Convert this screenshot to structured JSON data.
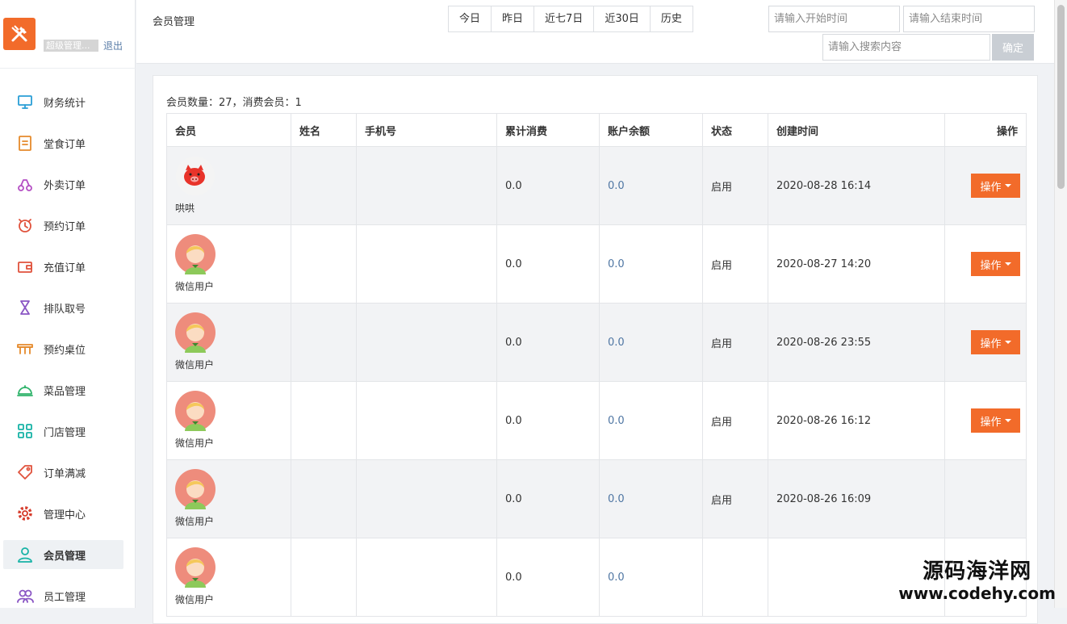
{
  "sidebar": {
    "brand_icon": "fork-knife-icon",
    "user_label": "超级管理...",
    "logout_label": "退出",
    "items": [
      {
        "label": "财务统计",
        "icon": "monitor-icon",
        "color": "#2a9ed6"
      },
      {
        "label": "堂食订单",
        "icon": "clipboard-icon",
        "color": "#e58a2c"
      },
      {
        "label": "外卖订单",
        "icon": "scooter-icon",
        "color": "#b44fc4"
      },
      {
        "label": "预约订单",
        "icon": "alarm-clock-icon",
        "color": "#e0523c"
      },
      {
        "label": "充值订单",
        "icon": "wallet-icon",
        "color": "#e0523c"
      },
      {
        "label": "排队取号",
        "icon": "hourglass-icon",
        "color": "#8a56c4"
      },
      {
        "label": "预约桌位",
        "icon": "table-icon",
        "color": "#e58a2c"
      },
      {
        "label": "菜品管理",
        "icon": "food-cover-icon",
        "color": "#2eb36a"
      },
      {
        "label": "门店管理",
        "icon": "grid-icon",
        "color": "#17b3a6"
      },
      {
        "label": "订单满减",
        "icon": "tag-icon",
        "color": "#e0523c"
      },
      {
        "label": "管理中心",
        "icon": "gear-icon",
        "color": "#d63c2c"
      },
      {
        "label": "会员管理",
        "icon": "user-icon",
        "color": "#17b3a6",
        "active": true
      },
      {
        "label": "员工管理",
        "icon": "users-icon",
        "color": "#8a56c4"
      }
    ]
  },
  "header": {
    "title": "会员管理",
    "ranges": [
      "今日",
      "昨日",
      "近七7日",
      "近30日",
      "历史"
    ],
    "start_placeholder": "请输入开始时间",
    "end_placeholder": "请输入结束时间",
    "search_placeholder": "请输入搜索内容",
    "confirm_label": "确定"
  },
  "content": {
    "summary": "会员数量：27，消费会员：1",
    "columns": [
      "会员",
      "姓名",
      "手机号",
      "累计消费",
      "账户余额",
      "状态",
      "创建时间",
      "操作"
    ],
    "rows": [
      {
        "avatar": "pig-avatar-icon",
        "member": "哄哄",
        "name": "",
        "phone": "",
        "total": "0.0",
        "balance": "0.0",
        "status": "启用",
        "created": "2020-08-28 16:14",
        "action": "操作"
      },
      {
        "avatar": "wechat-user-avatar-icon",
        "member": "微信用户",
        "name": "",
        "phone": "",
        "total": "0.0",
        "balance": "0.0",
        "status": "启用",
        "created": "2020-08-27 14:20",
        "action": "操作"
      },
      {
        "avatar": "wechat-user-avatar-icon",
        "member": "微信用户",
        "name": "",
        "phone": "",
        "total": "0.0",
        "balance": "0.0",
        "status": "启用",
        "created": "2020-08-26 23:55",
        "action": "操作"
      },
      {
        "avatar": "wechat-user-avatar-icon",
        "member": "微信用户",
        "name": "",
        "phone": "",
        "total": "0.0",
        "balance": "0.0",
        "status": "启用",
        "created": "2020-08-26 16:12",
        "action": "操作"
      },
      {
        "avatar": "wechat-user-avatar-icon",
        "member": "微信用户",
        "name": "",
        "phone": "",
        "total": "0.0",
        "balance": "0.0",
        "status": "启用",
        "created": "2020-08-26 16:09",
        "action": ""
      },
      {
        "avatar": "wechat-user-avatar-icon",
        "member": "微信用户",
        "name": "",
        "phone": "",
        "total": "0.0",
        "balance": "0.0",
        "status": "",
        "created": "",
        "action": ""
      }
    ]
  },
  "watermark": {
    "line1": "源码海洋网",
    "line2": "www.codehy.com"
  },
  "colors": {
    "accent": "#f26b2a",
    "balance": "#4f76a3"
  }
}
